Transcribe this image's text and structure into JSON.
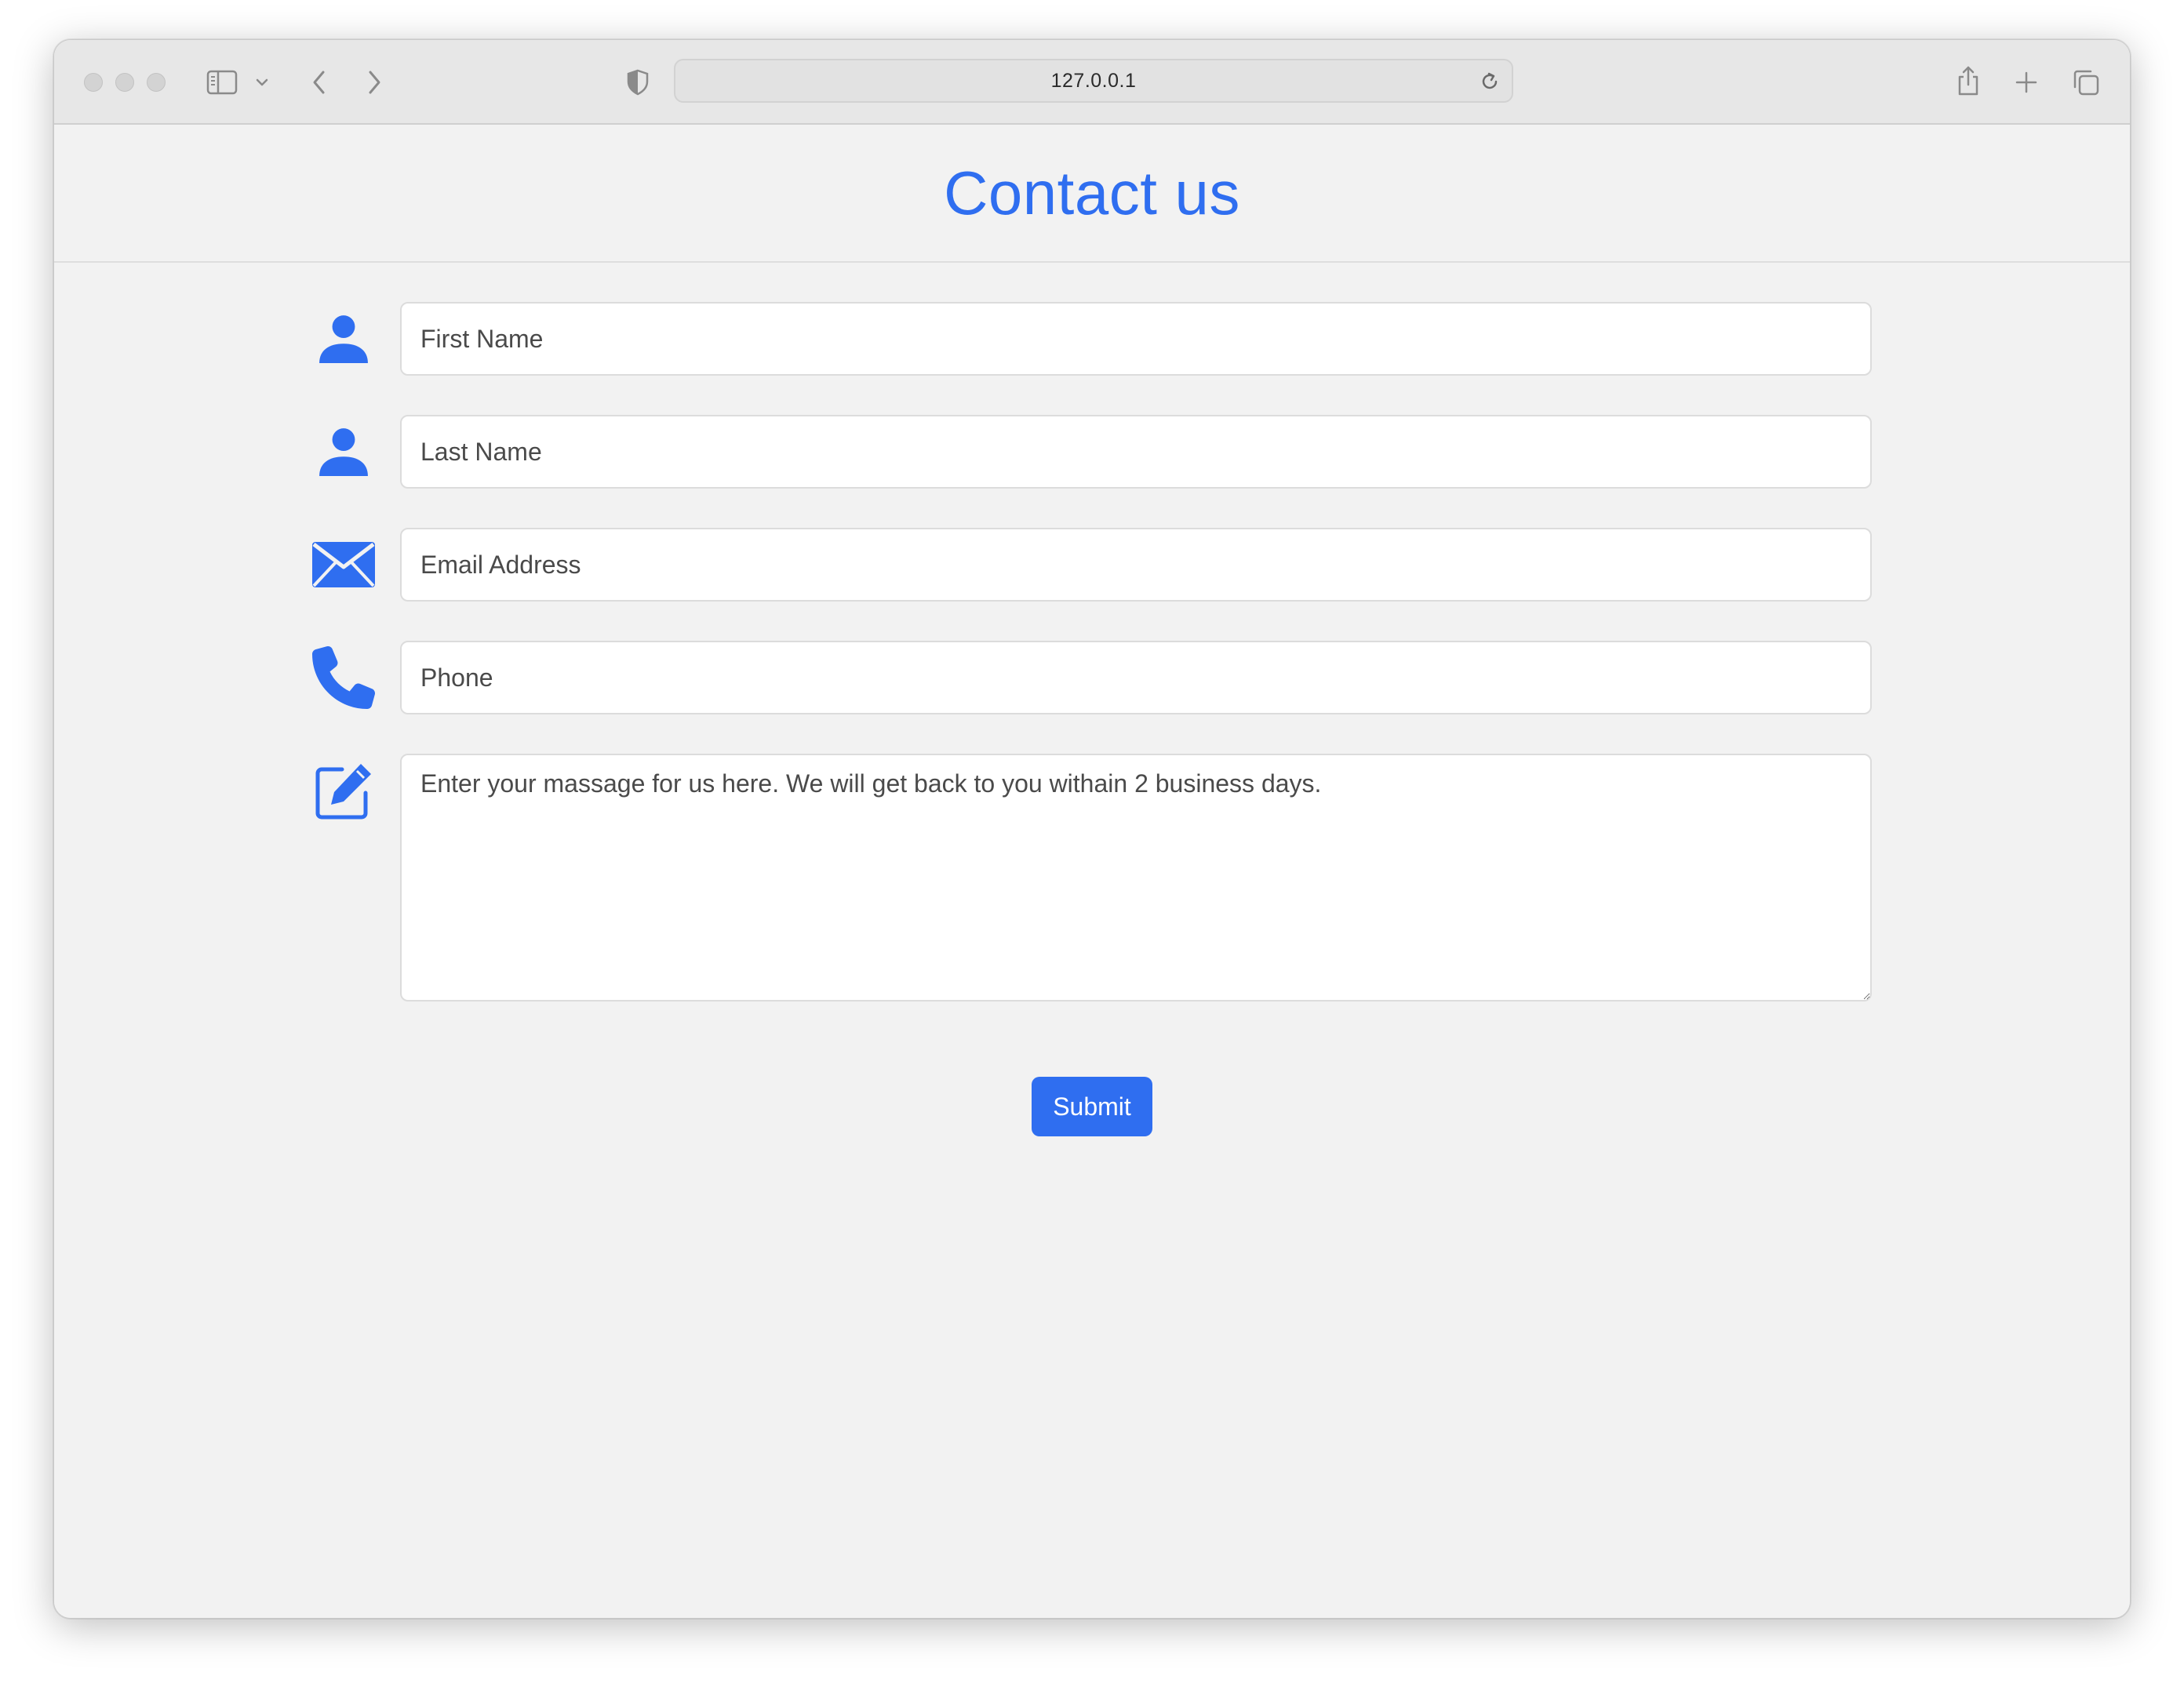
{
  "browser": {
    "url": "127.0.0.1",
    "icons": {
      "window_controls": [
        "close-button",
        "minimize-button",
        "zoom-button"
      ],
      "sidebar_toggle": "sidebar-icon",
      "sidebar_menu": "chevron-down-icon",
      "back": "chevron-left-icon",
      "forward": "chevron-right-icon",
      "privacy": "shield-icon",
      "reload": "reload-icon",
      "share": "share-icon",
      "new_tab": "plus-icon",
      "tabs_overview": "tabs-icon"
    }
  },
  "page": {
    "title": "Contact us",
    "accent_color": "#2f6ef0",
    "form": {
      "first_name": {
        "icon": "person-icon",
        "placeholder": "First Name",
        "value": ""
      },
      "last_name": {
        "icon": "person-icon",
        "placeholder": "Last Name",
        "value": ""
      },
      "email": {
        "icon": "envelope-icon",
        "placeholder": "Email Address",
        "value": ""
      },
      "phone": {
        "icon": "phone-icon",
        "placeholder": "Phone",
        "value": ""
      },
      "message": {
        "icon": "edit-icon",
        "placeholder": "Enter your massage for us here. We will get back to you withain 2 business days.",
        "value": ""
      },
      "submit_label": "Submit"
    }
  }
}
